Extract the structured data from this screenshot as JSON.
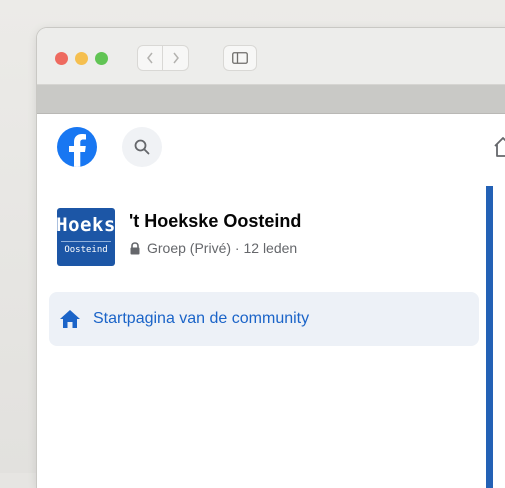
{
  "browser": {
    "traffic_lights": {
      "close": "#ee6a5f",
      "minimize": "#f5bf4f",
      "zoom": "#61c454"
    },
    "icons": {
      "back": "chevron-left-icon",
      "forward": "chevron-right-icon",
      "sidebar": "sidebar-icon"
    }
  },
  "header": {
    "logo_icon": "facebook-logo",
    "search_icon": "search-icon",
    "home_icon": "home-outline-icon",
    "brand_color": "#1877f2"
  },
  "group": {
    "thumbnail": {
      "top_text": "Hoeks",
      "bottom_text": "Oosteind"
    },
    "name": "'t Hoekske Oosteind",
    "privacy_icon": "lock-icon",
    "privacy": "Groep (Privé)",
    "separator": " · ",
    "member_count": "12 leden"
  },
  "nav": {
    "items": [
      {
        "icon": "home-icon",
        "label": "Startpagina van de community",
        "active": true,
        "color": "#1b64c8"
      }
    ]
  }
}
